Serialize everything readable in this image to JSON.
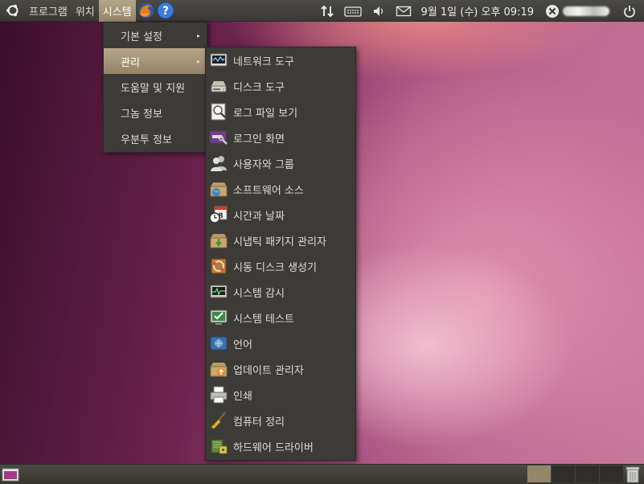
{
  "top_panel": {
    "menus": [
      {
        "label": "프로그램"
      },
      {
        "label": "위치"
      },
      {
        "label": "시스템"
      }
    ],
    "clock": "9월  1일 (수) 오후 09:19"
  },
  "system_menu": {
    "items": [
      {
        "label": "기본 설정",
        "has_submenu": true
      },
      {
        "label": "관리",
        "has_submenu": true,
        "highlighted": true
      },
      {
        "label": "도움말 및 지원"
      },
      {
        "label": "그놈 정보"
      },
      {
        "label": "우분투 정보"
      }
    ],
    "arrow": "▸"
  },
  "admin_menu": {
    "items": [
      {
        "label": "네트워크 도구",
        "icon": "network-tools-icon"
      },
      {
        "label": "디스크 도구",
        "icon": "disk-utility-icon"
      },
      {
        "label": "로그 파일 보기",
        "icon": "log-viewer-icon"
      },
      {
        "label": "로그인 화면",
        "icon": "login-screen-icon"
      },
      {
        "label": "사용자와 그룹",
        "icon": "users-groups-icon"
      },
      {
        "label": "소프트웨어 소스",
        "icon": "software-sources-icon"
      },
      {
        "label": "시간과 날짜",
        "icon": "time-date-icon"
      },
      {
        "label": "시냅틱 패키지 관리자",
        "icon": "synaptic-icon"
      },
      {
        "label": "시동 디스크 생성기",
        "icon": "startup-disk-icon"
      },
      {
        "label": "시스템 감시",
        "icon": "system-monitor-icon"
      },
      {
        "label": "시스템 테스트",
        "icon": "system-testing-icon"
      },
      {
        "label": "언어",
        "icon": "language-icon"
      },
      {
        "label": "업데이트 관리자",
        "icon": "update-manager-icon"
      },
      {
        "label": "인쇄",
        "icon": "printer-icon"
      },
      {
        "label": "컴퓨터 정리",
        "icon": "cleanup-broom-icon"
      },
      {
        "label": "하드웨어 드라이버",
        "icon": "hardware-drivers-icon"
      }
    ]
  },
  "colors": {
    "panel": "#3c3b37",
    "highlight": "#a5967a",
    "menu_text": "#dfdbd2"
  }
}
